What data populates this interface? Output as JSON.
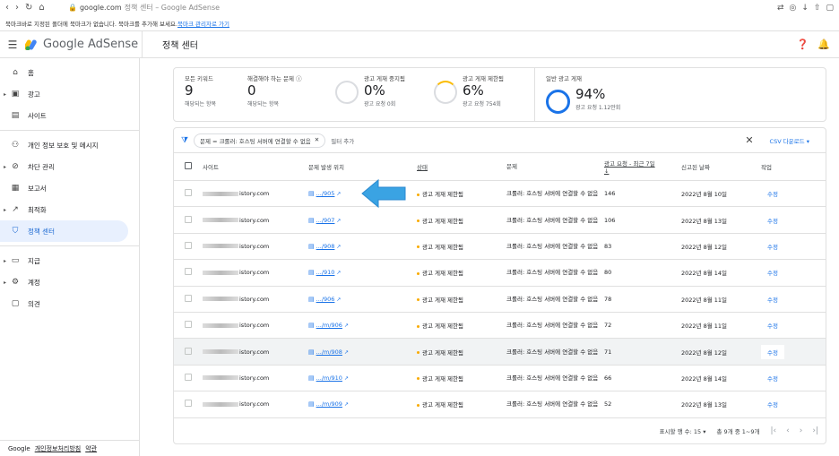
{
  "browser": {
    "url_domain": "google.com",
    "url_rest": "정책 센터 – Google AdSense"
  },
  "bookmark_bar": {
    "text": "북마크바로 지정된 폴더에 북마크가 없습니다. 북마크를 추가해 보세요.",
    "link": "북마크 관리자로 가기"
  },
  "header": {
    "brand": "Google AdSense",
    "title": "정책 센터"
  },
  "sidebar": {
    "items": [
      {
        "label": "홈",
        "icon": "home-icon"
      },
      {
        "label": "광고",
        "icon": "ads-icon"
      },
      {
        "label": "사이트",
        "icon": "sites-icon"
      },
      {
        "label": "개인 정보 보호 및 메시지",
        "icon": "privacy-icon"
      },
      {
        "label": "차단 관리",
        "icon": "block-icon"
      },
      {
        "label": "보고서",
        "icon": "reports-icon"
      },
      {
        "label": "최적화",
        "icon": "optimization-icon"
      },
      {
        "label": "정책 센터",
        "icon": "policy-icon"
      },
      {
        "label": "지급",
        "icon": "payments-icon"
      },
      {
        "label": "계정",
        "icon": "account-icon"
      },
      {
        "label": "의견",
        "icon": "feedback-icon"
      }
    ],
    "footer": {
      "brand": "Google",
      "privacy": "개인정보처리방침",
      "terms": "약관"
    }
  },
  "stats": {
    "all_issues": {
      "label": "모든 키워드",
      "value": "9",
      "sub": "해당되는 항목"
    },
    "must_fix": {
      "label": "해결해야 하는 문제",
      "value": "0",
      "sub": "해당되는 항목"
    },
    "stopped": {
      "label": "광고 게재 중지됨",
      "value": "0%",
      "sub": "광고 요청 0회"
    },
    "restricted": {
      "label": "광고 게재 제한됨",
      "value": "6%",
      "sub": "광고 요청 754회"
    },
    "normal": {
      "label": "일반 광고 게재",
      "value": "94%",
      "sub": "광고 요청 1.12만회"
    }
  },
  "filter": {
    "chip": "문제 = 크롤러: 호스팅 서버에 연결할 수 없음",
    "add": "필터 추가",
    "csv": "CSV 다운로드"
  },
  "table": {
    "headers": {
      "site": "사이트",
      "location": "문제 발생 위치",
      "status": "상태",
      "issue": "문제",
      "requests": "광고 요청 - 최근 7일",
      "date": "신고된 날짜",
      "action": "작업"
    },
    "rows": [
      {
        "site": "istory.com",
        "location": ".../905",
        "status": "광고 게재 제한됨",
        "issue": "크롤러: 호스팅 서버에 연결할 수 없음",
        "requests": "146",
        "date": "2022년 8월 10일",
        "action": "수정"
      },
      {
        "site": "istory.com",
        "location": ".../907",
        "status": "광고 게재 제한됨",
        "issue": "크롤러: 호스팅 서버에 연결할 수 없음",
        "requests": "106",
        "date": "2022년 8월 13일",
        "action": "수정"
      },
      {
        "site": "istory.com",
        "location": ".../908",
        "status": "광고 게재 제한됨",
        "issue": "크롤러: 호스팅 서버에 연결할 수 없음",
        "requests": "83",
        "date": "2022년 8월 12일",
        "action": "수정"
      },
      {
        "site": "istory.com",
        "location": ".../910",
        "status": "광고 게재 제한됨",
        "issue": "크롤러: 호스팅 서버에 연결할 수 없음",
        "requests": "80",
        "date": "2022년 8월 14일",
        "action": "수정"
      },
      {
        "site": "istory.com",
        "location": ".../906",
        "status": "광고 게재 제한됨",
        "issue": "크롤러: 호스팅 서버에 연결할 수 없음",
        "requests": "78",
        "date": "2022년 8월 11일",
        "action": "수정"
      },
      {
        "site": "istory.com",
        "location": ".../m/906",
        "status": "광고 게재 제한됨",
        "issue": "크롤러: 호스팅 서버에 연결할 수 없음",
        "requests": "72",
        "date": "2022년 8월 11일",
        "action": "수정"
      },
      {
        "site": "istory.com",
        "location": ".../m/908",
        "status": "광고 게재 제한됨",
        "issue": "크롤러: 호스팅 서버에 연결할 수 없음",
        "requests": "71",
        "date": "2022년 8월 12일",
        "action": "수정"
      },
      {
        "site": "istory.com",
        "location": ".../m/910",
        "status": "광고 게재 제한됨",
        "issue": "크롤러: 호스팅 서버에 연결할 수 없음",
        "requests": "66",
        "date": "2022년 8월 14일",
        "action": "수정"
      },
      {
        "site": "istory.com",
        "location": ".../m/909",
        "status": "광고 게재 제한됨",
        "issue": "크롤러: 호스팅 서버에 연결할 수 없음",
        "requests": "52",
        "date": "2022년 8월 13일",
        "action": "수정"
      }
    ]
  },
  "pagination": {
    "rows_label": "표시할 행 수:",
    "rows_value": "15",
    "range": "총 9개 중 1~9개"
  },
  "colors": {
    "accent": "#1a73e8",
    "warning": "#f9ab00",
    "active_bg": "#e8f0fe"
  }
}
